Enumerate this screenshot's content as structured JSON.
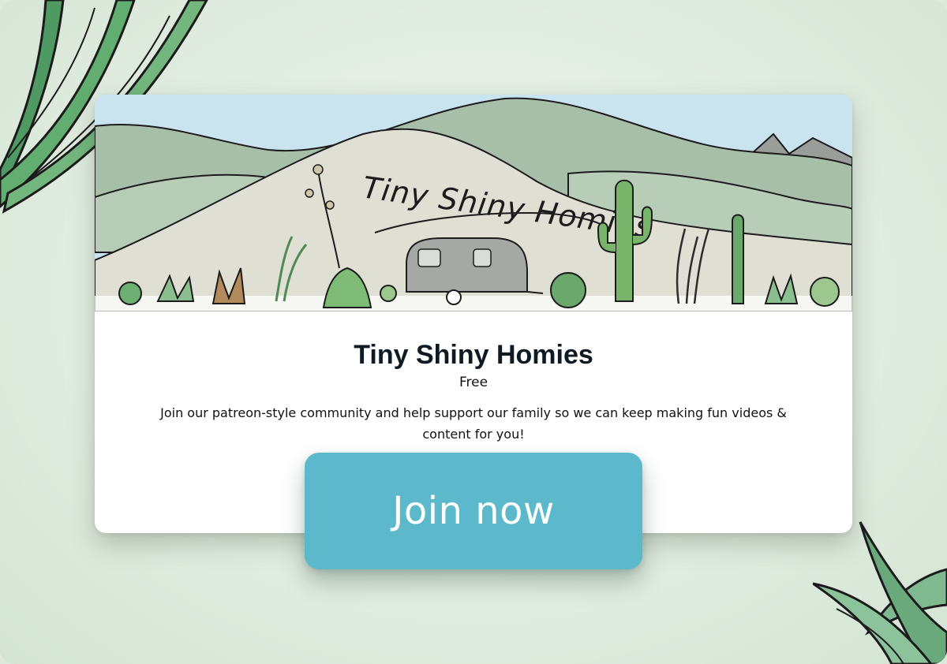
{
  "banner": {
    "title": "Tiny Shiny Homies"
  },
  "card": {
    "title": "Tiny Shiny Homies",
    "price": "Free",
    "description": "Join our patreon-style community and help support our family so we can keep making fun videos & content for you!"
  },
  "cta": {
    "label": "Join now"
  },
  "colors": {
    "accent": "#5cb9cb",
    "background": "#dde9dd",
    "card": "#ffffff",
    "title_text": "#0e1a24"
  },
  "icons": [
    "agave-leaves-decoration",
    "succulent-decoration",
    "saguaro-cactus-icon",
    "airstream-trailer-icon",
    "mountains-illustration"
  ]
}
